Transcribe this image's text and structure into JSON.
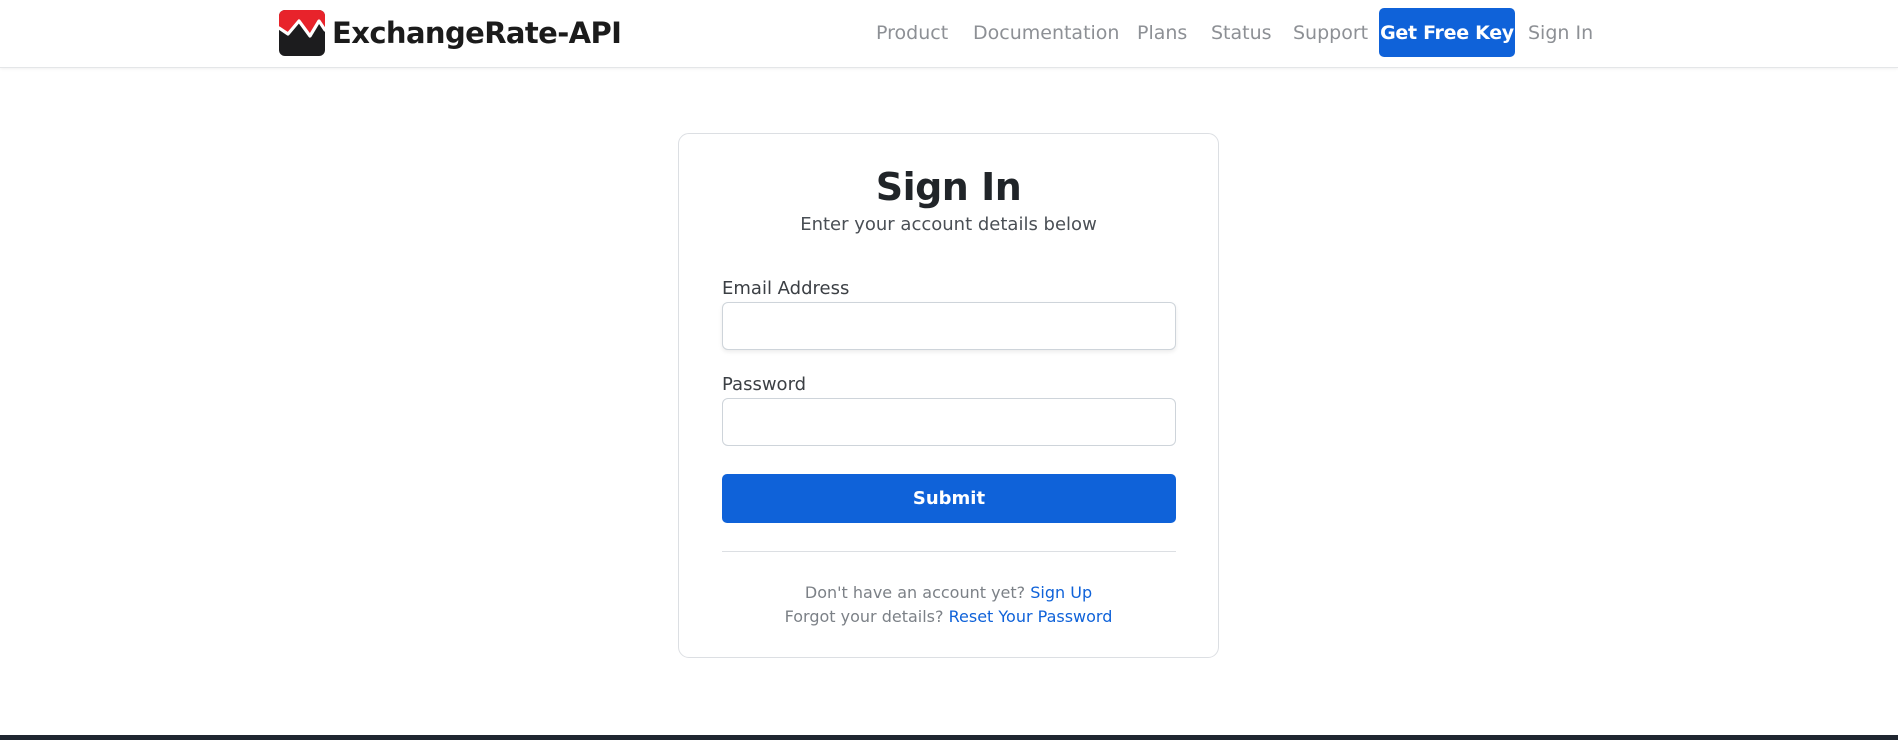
{
  "brand": {
    "name": "ExchangeRate-API",
    "logo_icon": "exchange-rate-chart-logo-icon",
    "logo_colors": {
      "top": "#e8232b",
      "bottom": "#1c1c1e"
    }
  },
  "nav": {
    "links": [
      "Product",
      "Documentation",
      "Plans",
      "Status",
      "Support"
    ],
    "cta_label": "Get Free Key",
    "signin_label": "Sign In"
  },
  "form": {
    "title": "Sign In",
    "subtitle": "Enter your account details below",
    "email_label": "Email Address",
    "email_value": "",
    "password_label": "Password",
    "password_value": "",
    "submit_label": "Submit",
    "signup_prompt": "Don't have an account yet?",
    "signup_link": "Sign Up",
    "reset_prompt": "Forgot your details?",
    "reset_link": "Reset Your Password"
  },
  "colors": {
    "accent": "#0f62d9",
    "nav_text": "#8d9095"
  }
}
